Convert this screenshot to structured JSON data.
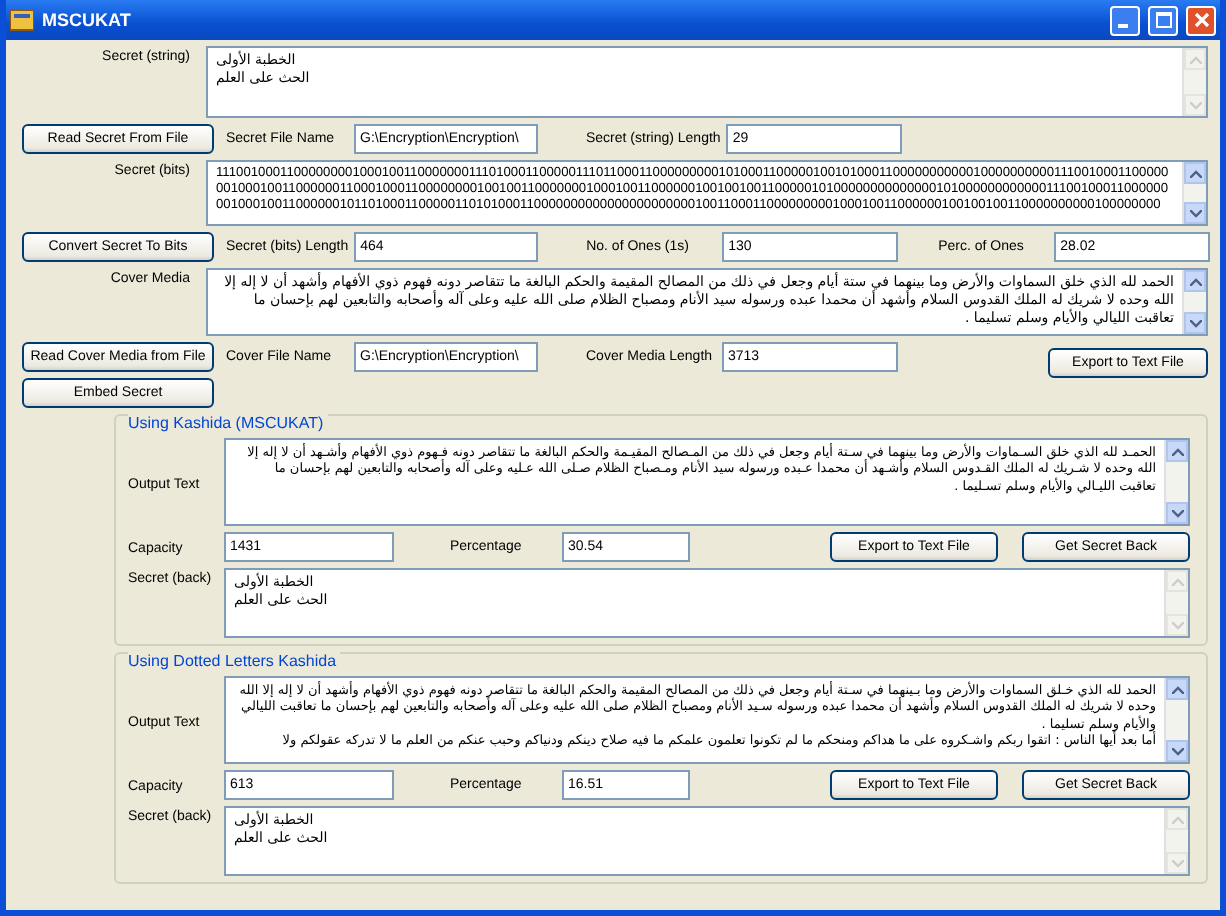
{
  "window": {
    "title": "MSCUKAT"
  },
  "secret_string": {
    "label": "Secret (string)",
    "value": "الخطبة الأولى\nالحث على العلم"
  },
  "read_secret_button": "Read Secret From File",
  "secret_file_name": {
    "label": "Secret File Name",
    "value": "G:\\Encryption\\Encryption\\"
  },
  "secret_length": {
    "label": "Secret (string) Length",
    "value": "29"
  },
  "secret_bits": {
    "label": "Secret (bits)",
    "value": "111001000110000000010001001100000001110100011000001110110001100000000010100011000001001010001100000000000100000000001110010001100000001000100110000001100010001100000000100100110000000100010011000000100100100110000010100000000000000101000000000000111001000110000000010001001100000010110100011000001101010001100000000000000000000001001100011000000000100010011000000100100100110000000000100000000"
  },
  "convert_button": "Convert Secret To Bits",
  "bits_length": {
    "label": "Secret (bits) Length",
    "value": "464"
  },
  "ones_count": {
    "label": "No. of Ones (1s)",
    "value": "130"
  },
  "ones_percent": {
    "label": "Perc. of Ones",
    "value": "28.02"
  },
  "cover_media": {
    "label": "Cover Media",
    "value": "الحمد لله الذي خلق السماوات والأرض وما بينهما في ستة أيام وجعل في ذلك من المصالح المقيمة والحكم البالغة ما تتقاصر دونه فهوم ذوي الأفهام وأشهد أن لا إله إلا الله وحده لا شريك له الملك القدوس السلام وأشهد أن محمدا عبده ورسوله سيد الأنام ومصباح الظلام صلى الله عليه وعلى آله وأصحابه والتابعين لهم بإحسان ما تعاقبت الليالي والأيام وسلم تسليما ."
  },
  "read_cover_button": "Read Cover Media from File",
  "cover_file_name": {
    "label": "Cover File Name",
    "value": "G:\\Encryption\\Encryption\\"
  },
  "cover_length": {
    "label": "Cover Media Length",
    "value": "3713"
  },
  "export_button": "Export to Text File",
  "embed_button": "Embed Secret",
  "groups": [
    {
      "title": "Using Kashida (MSCUKAT)",
      "output_label": "Output Text",
      "output_text": "الحمـد لله الذي خلق السـماوات والأرض وما بينهما في سـتة أيام وجعل في ذلك من المـصالح المقيـمة والحكم البالغة ما تتقاصر دونه فـهوم ذوي الأفهام وأشـهد أن لا إله إلا الله وحده لا شـريك له الملك القـدوس السلام وأشـهد أن محمدا عـبده ورسوله سيد الأنام ومـصباح الظلام صـلى الله عـليه وعلى آله وأصحابه والتابعين لهم بإحسان ما تعاقبت الليـالي والأيام وسلم تسـليما .",
      "capacity": {
        "label": "Capacity",
        "value": "1431"
      },
      "percentage": {
        "label": "Percentage",
        "value": "30.54"
      },
      "export_button": "Export to Text File",
      "get_secret_button": "Get Secret Back",
      "secret_back": {
        "label": "Secret (back)",
        "value": "الخطبة الأولى\nالحث على العلم"
      }
    },
    {
      "title": "Using Dotted Letters Kashida",
      "output_label": "Output Text",
      "output_text": "الحمد لله الذي خـلق السماوات والأرض وما بـينهما في سـتة أيام وجعل في ذلك من المصالح المقيمة والحكم البالغة ما تتقاصر دونه فهوم ذوي الأفهام وأشهد أن لا إله إلا الله وحده لا شريك له الملك القدوس السلام وأشهد أن محمدا عبده ورسوله سـيد الأنام ومصباح الظلام صلى الله عليه وعلى آله وأصحابه والتابعين لهم بإحسان ما تعاقبت الليالي والأيام وسلم تسليما .\nأما بعد أيها الناس : اتقوا ربكم واشـكروه على ما هداكم ومنحكم ما لم تكونوا تعلمون علمكم ما فيه صلاح دينكم ودنياكم وحبب عنكم من العلم ما لا تدركه عقولكم ولا",
      "capacity": {
        "label": "Capacity",
        "value": "613"
      },
      "percentage": {
        "label": "Percentage",
        "value": "16.51"
      },
      "export_button": "Export to Text File",
      "get_secret_button": "Get Secret Back",
      "secret_back": {
        "label": "Secret (back)",
        "value": "الخطبة الأولى\nالحث على العلم"
      }
    }
  ]
}
